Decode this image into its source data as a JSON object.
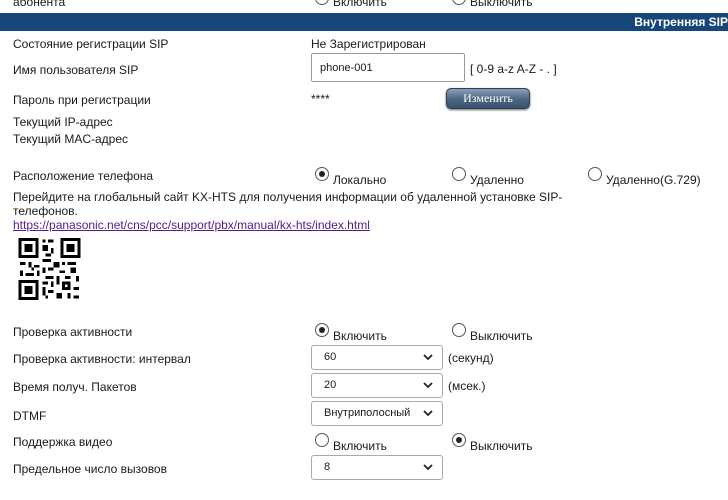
{
  "top_partial": {
    "label": "абонента",
    "opt_on": "Включить",
    "opt_off": "Выключить"
  },
  "section": {
    "title": "Внутренняя SIP"
  },
  "rows": {
    "reg_state_label": "Состояние регистрации SIP",
    "reg_state_value": "Не Зарегистрирован",
    "username_label": "Имя пользователя SIP",
    "username_value": "phone-001",
    "username_hint": "[ 0-9 a-z A-Z - . ]",
    "password_label": "Пароль при регистрации",
    "password_value": "****",
    "change_button": "Изменить",
    "ip_label": "Текущий IP-адрес",
    "mac_label": "Текущий MAC-адрес",
    "location_label": "Расположение телефона",
    "location_options": [
      "Локально",
      "Удаленно",
      "Удаленно(G.729)"
    ],
    "location_selected": 0,
    "info_line1": "Перейдите на глобальный сайт KX-HTS для получения информации об удаленной установке SIP-",
    "info_line2": "телефонов.",
    "info_link": "https://panasonic.net/cns/pcc/support/pbx/manual/kx-hts/index.html",
    "keepalive_label": "Проверка активности",
    "keepalive_on": "Включить",
    "keepalive_off": "Выключить",
    "keepalive_selected": "on",
    "keepalive_interval_label": "Проверка активности: интервал",
    "keepalive_interval_value": "60",
    "keepalive_interval_unit": "(секунд)",
    "packet_time_label": "Время получ. Пакетов",
    "packet_time_value": "20",
    "packet_time_unit": "(мсек.)",
    "dtmf_label": "DTMF",
    "dtmf_value": "Внутриполосный",
    "video_label": "Поддержка видео",
    "video_on": "Включить",
    "video_off": "Выключить",
    "video_selected": "off",
    "max_calls_label": "Предельное число вызовов",
    "max_calls_value": "8"
  },
  "colors": {
    "header_bar": "#17467a",
    "link": "#551a8b"
  },
  "icons": {
    "dropdown": "chevron-down-icon",
    "qr": "qr-code-icon"
  }
}
